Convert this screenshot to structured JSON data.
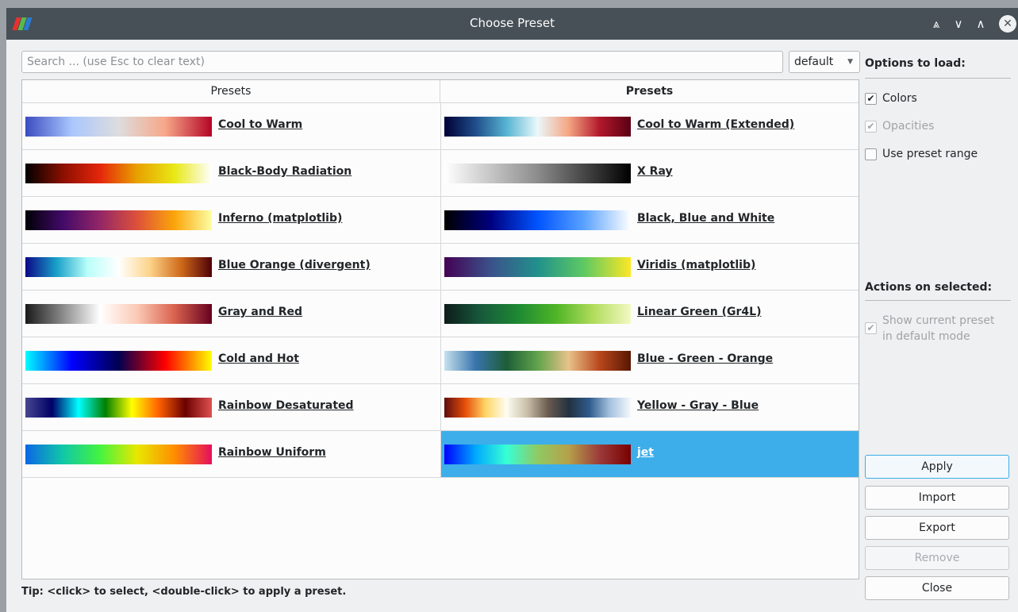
{
  "window": {
    "title": "Choose Preset",
    "colors": {
      "titlebar": "#475057",
      "accent": "#3daee9",
      "background": "#eff0f1"
    }
  },
  "titlebar_buttons": [
    {
      "name": "keep-above-icon",
      "glyph": "⩓"
    },
    {
      "name": "minimize-icon",
      "glyph": "∨"
    },
    {
      "name": "maximize-icon",
      "glyph": "∧"
    },
    {
      "name": "close-icon",
      "glyph": "✕"
    }
  ],
  "search": {
    "placeholder": "Search ... (use Esc to clear text)",
    "value": ""
  },
  "mode_combo": {
    "selected": "default"
  },
  "table": {
    "headers": [
      "Presets",
      "Presets"
    ],
    "rows": [
      [
        {
          "label": "Cool to Warm",
          "colors": [
            "#3b4cc0",
            "#aac7fd",
            "#dddddd",
            "#f7a789",
            "#b40426"
          ]
        },
        {
          "label": "Cool to Warm (Extended)",
          "colors": [
            "#000034",
            "#1f4d8a",
            "#56b4d2",
            "#eaf8fb",
            "#f4a582",
            "#b2182b",
            "#5a0014"
          ]
        }
      ],
      [
        {
          "label": "Black-Body Radiation",
          "colors": [
            "#000000",
            "#8a0f00",
            "#e5260b",
            "#e8a100",
            "#e8e816",
            "#ffffff"
          ]
        },
        {
          "label": "X Ray",
          "colors": [
            "#ffffff",
            "#8c8c8c",
            "#000000"
          ]
        }
      ],
      [
        {
          "label": "Inferno (matplotlib)",
          "colors": [
            "#000004",
            "#420a68",
            "#932667",
            "#dd513a",
            "#fca50a",
            "#fcffa4"
          ]
        },
        {
          "label": "Black, Blue and White",
          "colors": [
            "#000000",
            "#000080",
            "#0054ff",
            "#5aa2ff",
            "#ffffff"
          ]
        }
      ],
      [
        {
          "label": "Blue Orange (divergent)",
          "colors": [
            "#0c0787",
            "#18a0c9",
            "#b9fff9",
            "#ffffff",
            "#fcd48a",
            "#d06a1a",
            "#4f0008"
          ]
        },
        {
          "label": "Viridis (matplotlib)",
          "colors": [
            "#440154",
            "#3b528b",
            "#21918c",
            "#5ec962",
            "#fde725"
          ]
        }
      ],
      [
        {
          "label": "Gray and Red",
          "colors": [
            "#1a1a1a",
            "#8a8a8a",
            "#ffffff",
            "#fbc9b4",
            "#d9624f",
            "#67001f"
          ]
        },
        {
          "label": "Linear Green (Gr4L)",
          "colors": [
            "#0d1c1a",
            "#175a3c",
            "#1e8a32",
            "#4fb526",
            "#b2dc5c",
            "#f3f9c2"
          ]
        }
      ],
      [
        {
          "label": "Cold and Hot",
          "colors": [
            "#00ffff",
            "#0000ff",
            "#000050",
            "#ff0000",
            "#ffff00"
          ]
        },
        {
          "label": "Blue - Green - Orange",
          "colors": [
            "#c7e1ee",
            "#3875ad",
            "#1d5d37",
            "#60a34b",
            "#e8c28a",
            "#b8461c",
            "#581803"
          ]
        }
      ],
      [
        {
          "label": "Rainbow Desaturated",
          "colors": [
            "#474791",
            "#000068",
            "#00ffff",
            "#008000",
            "#ffff00",
            "#ff6100",
            "#6b0000",
            "#e05050"
          ]
        },
        {
          "label": "Yellow - Gray - Blue",
          "colors": [
            "#5c0c0c",
            "#e64e0a",
            "#ffd766",
            "#fdfdf1",
            "#c9bfa8",
            "#6b5c4f",
            "#22313f",
            "#2f5b8c",
            "#a6c3e0",
            "#f5f8fb"
          ]
        }
      ],
      [
        {
          "label": "Rainbow Uniform",
          "colors": [
            "#0c67e6",
            "#10c7a8",
            "#44f340",
            "#e8e800",
            "#ff8d00",
            "#e50f5d"
          ]
        },
        {
          "label": "jet",
          "colors": [
            "#0000ff",
            "#00a8ff",
            "#37ffd6",
            "#8fca63",
            "#b6a04a",
            "#9b3a3a",
            "#7a0000"
          ],
          "selected": true
        }
      ]
    ]
  },
  "side_panel": {
    "options_title": "Options to load:",
    "colors_label": "Colors",
    "opacities_label": "Opacities",
    "use_range_label": "Use preset range",
    "actions_title": "Actions on selected:",
    "show_current_line1": "Show current preset",
    "show_current_line2": "in default mode"
  },
  "buttons": {
    "apply": "Apply",
    "import": "Import",
    "export": "Export",
    "remove": "Remove",
    "close": "Close"
  },
  "tip": "Tip: <click> to select, <double-click> to apply a preset."
}
